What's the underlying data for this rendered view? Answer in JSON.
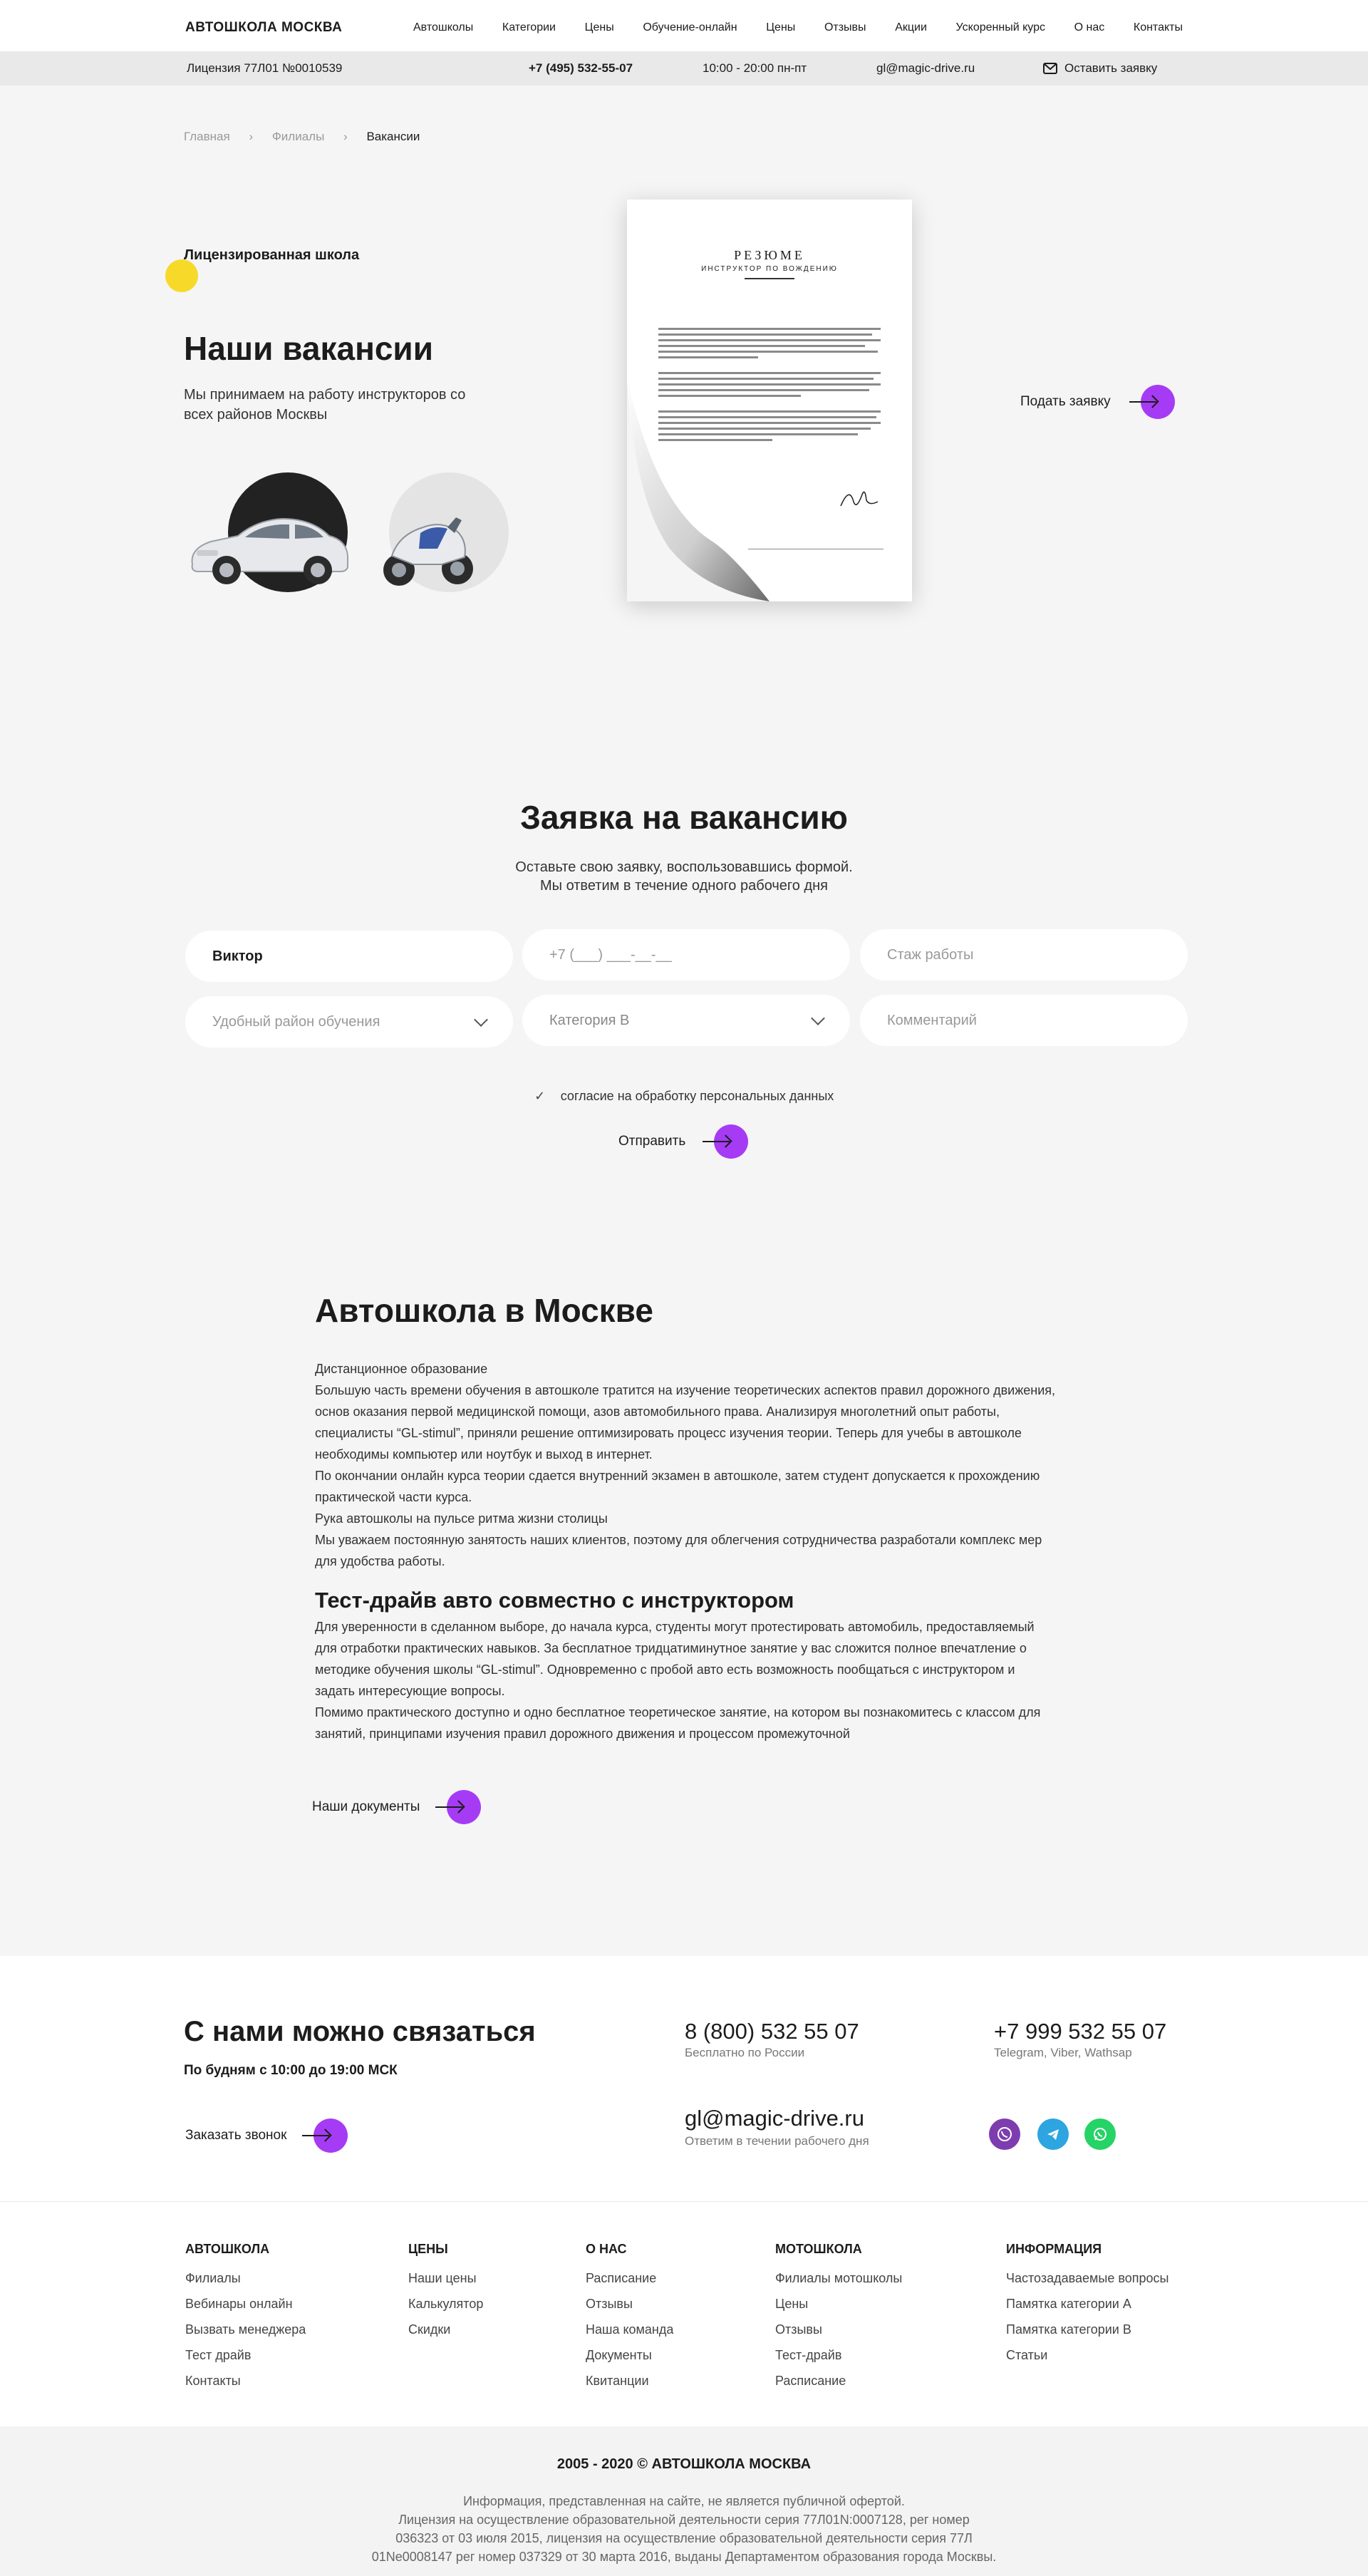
{
  "header": {
    "logo": "АВТОШКОЛА МОСКВА",
    "nav": [
      "Автошколы",
      "Категории",
      "Цены",
      "Обучение-онлайн",
      "Цены",
      "Отзывы",
      "Акции",
      "Ускоренный курс",
      "О нас",
      "Контакты"
    ],
    "license": "Лицензия 77Л01 №0010539",
    "phone": "+7 (495) 532-55-07",
    "hours": "10:00 - 20:00 пн-пт",
    "email": "gl@magic-drive.ru",
    "request": "Оставить заявку"
  },
  "breadcrumb": [
    "Главная",
    "Филиалы",
    "Вакансии"
  ],
  "hero": {
    "badge": "Лицензированная школа",
    "title": "Наши вакансии",
    "subtitle": "Мы принимаем на работу инструкторов со всех районов Москвы",
    "apply": "Подать заявку",
    "resume": {
      "title": "РЕЗЮМЕ",
      "subtitle": "ИНСТРУКТОР ПО ВОЖДЕНИЮ"
    }
  },
  "form": {
    "title": "Заявка на вакансию",
    "subtitle_1": "Оставьте свою заявку, воспользовавшись формой.",
    "subtitle_2": "Мы ответим в течение одного рабочего дня",
    "name_value": "Виктор",
    "phone_placeholder": "+7 (___) ___-__-__",
    "experience_placeholder": "Стаж работы",
    "district_placeholder": "Удобный район обучения",
    "category_value": "Категория B",
    "comment_placeholder": "Комментарий",
    "consent": "согласие на обработку персональных данных",
    "submit": "Отправить"
  },
  "article": {
    "title": "Автошкола в Москве",
    "paragraphs_1": [
      "Дистанционное образование",
      "Большую часть времени обучения в автошколе тратится на изучение теоретических аспектов правил дорожного движения, основ оказания первой медицинской помощи, азов автомобильного права. Анализируя многолетний опыт работы, специалисты “GL-stimul”, приняли решение оптимизировать процесс изучения теории. Теперь для учебы в автошколе необходимы компьютер или ноутбук и выход в интернет.",
      "По окончании онлайн курса теории сдается внутренний экзамен в автошколе, затем студент допускается к прохождению практической части курса.",
      "Рука автошколы на пульсе ритма жизни столицы",
      "Мы уважаем постоянную занятость наших клиентов, поэтому для облегчения сотрудничества разработали комплекс мер для удобства работы."
    ],
    "subtitle": "Тест-драйв авто совместно с инструктором",
    "paragraphs_2": [
      "Для уверенности в сделанном выборе, до начала курса, студенты могут протестировать автомобиль, предоставляемый для отработки практических навыков. За бесплатное тридцатиминутное занятие у вас сложится полное впечатление о методике обучения школы “GL-stimul”. Одновременно с пробой авто есть возможность пообщаться с инструктором и задать интересующие вопросы.",
      "Помимо практического доступно и одно бесплатное теоретическое занятие, на котором вы познакомитесь с классом для занятий, принципами изучения правил дорожного движения и процессом промежуточной"
    ],
    "docs_link": "Наши документы"
  },
  "contacts": {
    "title": "С нами можно связаться",
    "hours": "По будням с 10:00 до 19:00 МСК",
    "callback": "Заказать звонок",
    "phone_free": "8 (800) 532 55 07",
    "phone_free_note": "Бесплатно по России",
    "phone_mobile": "+7 999 532 55 07",
    "phone_mobile_note": "Telegram, Viber, Wathsap",
    "email": "gl@magic-drive.ru",
    "email_note": "Ответим в течении рабочего дня",
    "colors": {
      "viber": "#7d3daf",
      "telegram": "#2ca5e0",
      "whatsapp": "#25d366"
    }
  },
  "footer": {
    "columns": [
      {
        "title": "АВТОШКОЛА",
        "items": [
          "Филиалы",
          "Вебинары онлайн",
          "Вызвать менеджера",
          "Тест драйв",
          "Контакты"
        ]
      },
      {
        "title": "ЦЕНЫ",
        "items": [
          "Наши цены",
          "Калькулятор",
          "Скидки"
        ]
      },
      {
        "title": "О НАС",
        "items": [
          "Расписание",
          "Отзывы",
          "Наша команда",
          "Документы",
          "Квитанции"
        ]
      },
      {
        "title": "МОТОШКОЛА",
        "items": [
          "Филиалы мотошколы",
          "Цены",
          "Отзывы",
          "Тест-драйв",
          "Расписание"
        ]
      },
      {
        "title": "ИНФОРМАЦИЯ",
        "items": [
          "Частозадаваемые вопросы",
          "Памятка категории A",
          "Памятка категории B",
          "Статьи"
        ]
      }
    ],
    "copyright": "2005 - 2020 © АВТОШКОЛА МОСКВА",
    "legal_1": "Информация, представленная на сайте, не является публичной офертой.",
    "legal_2": "Лицензия на осуществление образовательной деятельности серия 77Л01N:0007128, рег номер",
    "legal_3": "036323 от 03 июля 2015, лицензия на осуществление образовательной деятельности серия 77Л",
    "legal_4": "01Ne0008147 рег номер 037329 от 30 марта 2016, выданы Департаментом образования города Москвы."
  },
  "colors": {
    "accent": "#a63bf5",
    "yellow": "#f7d92a",
    "background": "#f5f5f5"
  }
}
